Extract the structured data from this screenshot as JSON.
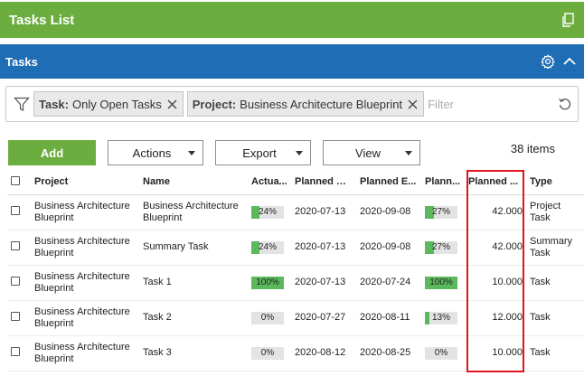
{
  "window": {
    "title": "Tasks List",
    "popout_icon": "popout-icon"
  },
  "panel": {
    "title": "Tasks",
    "settings_icon": "gear-icon",
    "collapse_icon": "chevron-up-icon"
  },
  "filter": {
    "chips": [
      {
        "key": "Task:",
        "value": "Only Open Tasks"
      },
      {
        "key": "Project:",
        "value": "Business Architecture Blueprint"
      }
    ],
    "placeholder": "Filter"
  },
  "toolbar": {
    "add_label": "Add",
    "actions_label": "Actions",
    "export_label": "Export",
    "view_label": "View",
    "item_count": "38 items"
  },
  "table": {
    "columns": [
      "Project",
      "Name",
      "Actual Progress",
      "Planned Start",
      "Planned End",
      "Planned Progress",
      "Planned Work",
      "Type"
    ],
    "column_display": [
      "Project",
      "Name",
      "Actua...",
      "Planned St...",
      "Planned E...",
      "Plann...",
      "Planned ...",
      "Type"
    ],
    "rows": [
      {
        "project": "Business Architecture Blueprint",
        "name": "Business Architecture Blueprint",
        "actual": "24%",
        "actual_pct": 24,
        "start": "2020-07-13",
        "end": "2020-09-08",
        "planned": "27%",
        "planned_pct": 27,
        "work": "42.000",
        "type": "Project Task"
      },
      {
        "project": "Business Architecture Blueprint",
        "name": "Summary Task",
        "actual": "24%",
        "actual_pct": 24,
        "start": "2020-07-13",
        "end": "2020-09-08",
        "planned": "27%",
        "planned_pct": 27,
        "work": "42.000",
        "type": "Summary Task"
      },
      {
        "project": "Business Architecture Blueprint",
        "name": "Task 1",
        "actual": "100%",
        "actual_pct": 100,
        "start": "2020-07-13",
        "end": "2020-07-24",
        "planned": "100%",
        "planned_pct": 100,
        "work": "10.000",
        "type": "Task"
      },
      {
        "project": "Business Architecture Blueprint",
        "name": "Task 2",
        "actual": "0%",
        "actual_pct": 0,
        "start": "2020-07-27",
        "end": "2020-08-11",
        "planned": "13%",
        "planned_pct": 13,
        "work": "12.000",
        "type": "Task"
      },
      {
        "project": "Business Architecture Blueprint",
        "name": "Task 3",
        "actual": "0%",
        "actual_pct": 0,
        "start": "2020-08-12",
        "end": "2020-08-25",
        "planned": "0%",
        "planned_pct": 0,
        "work": "10.000",
        "type": "Task"
      }
    ]
  },
  "colors": {
    "header_green": "#6cad3f",
    "panel_blue": "#1f6db5",
    "progress_green": "#5cb85c",
    "highlight_red": "#e0141e"
  }
}
